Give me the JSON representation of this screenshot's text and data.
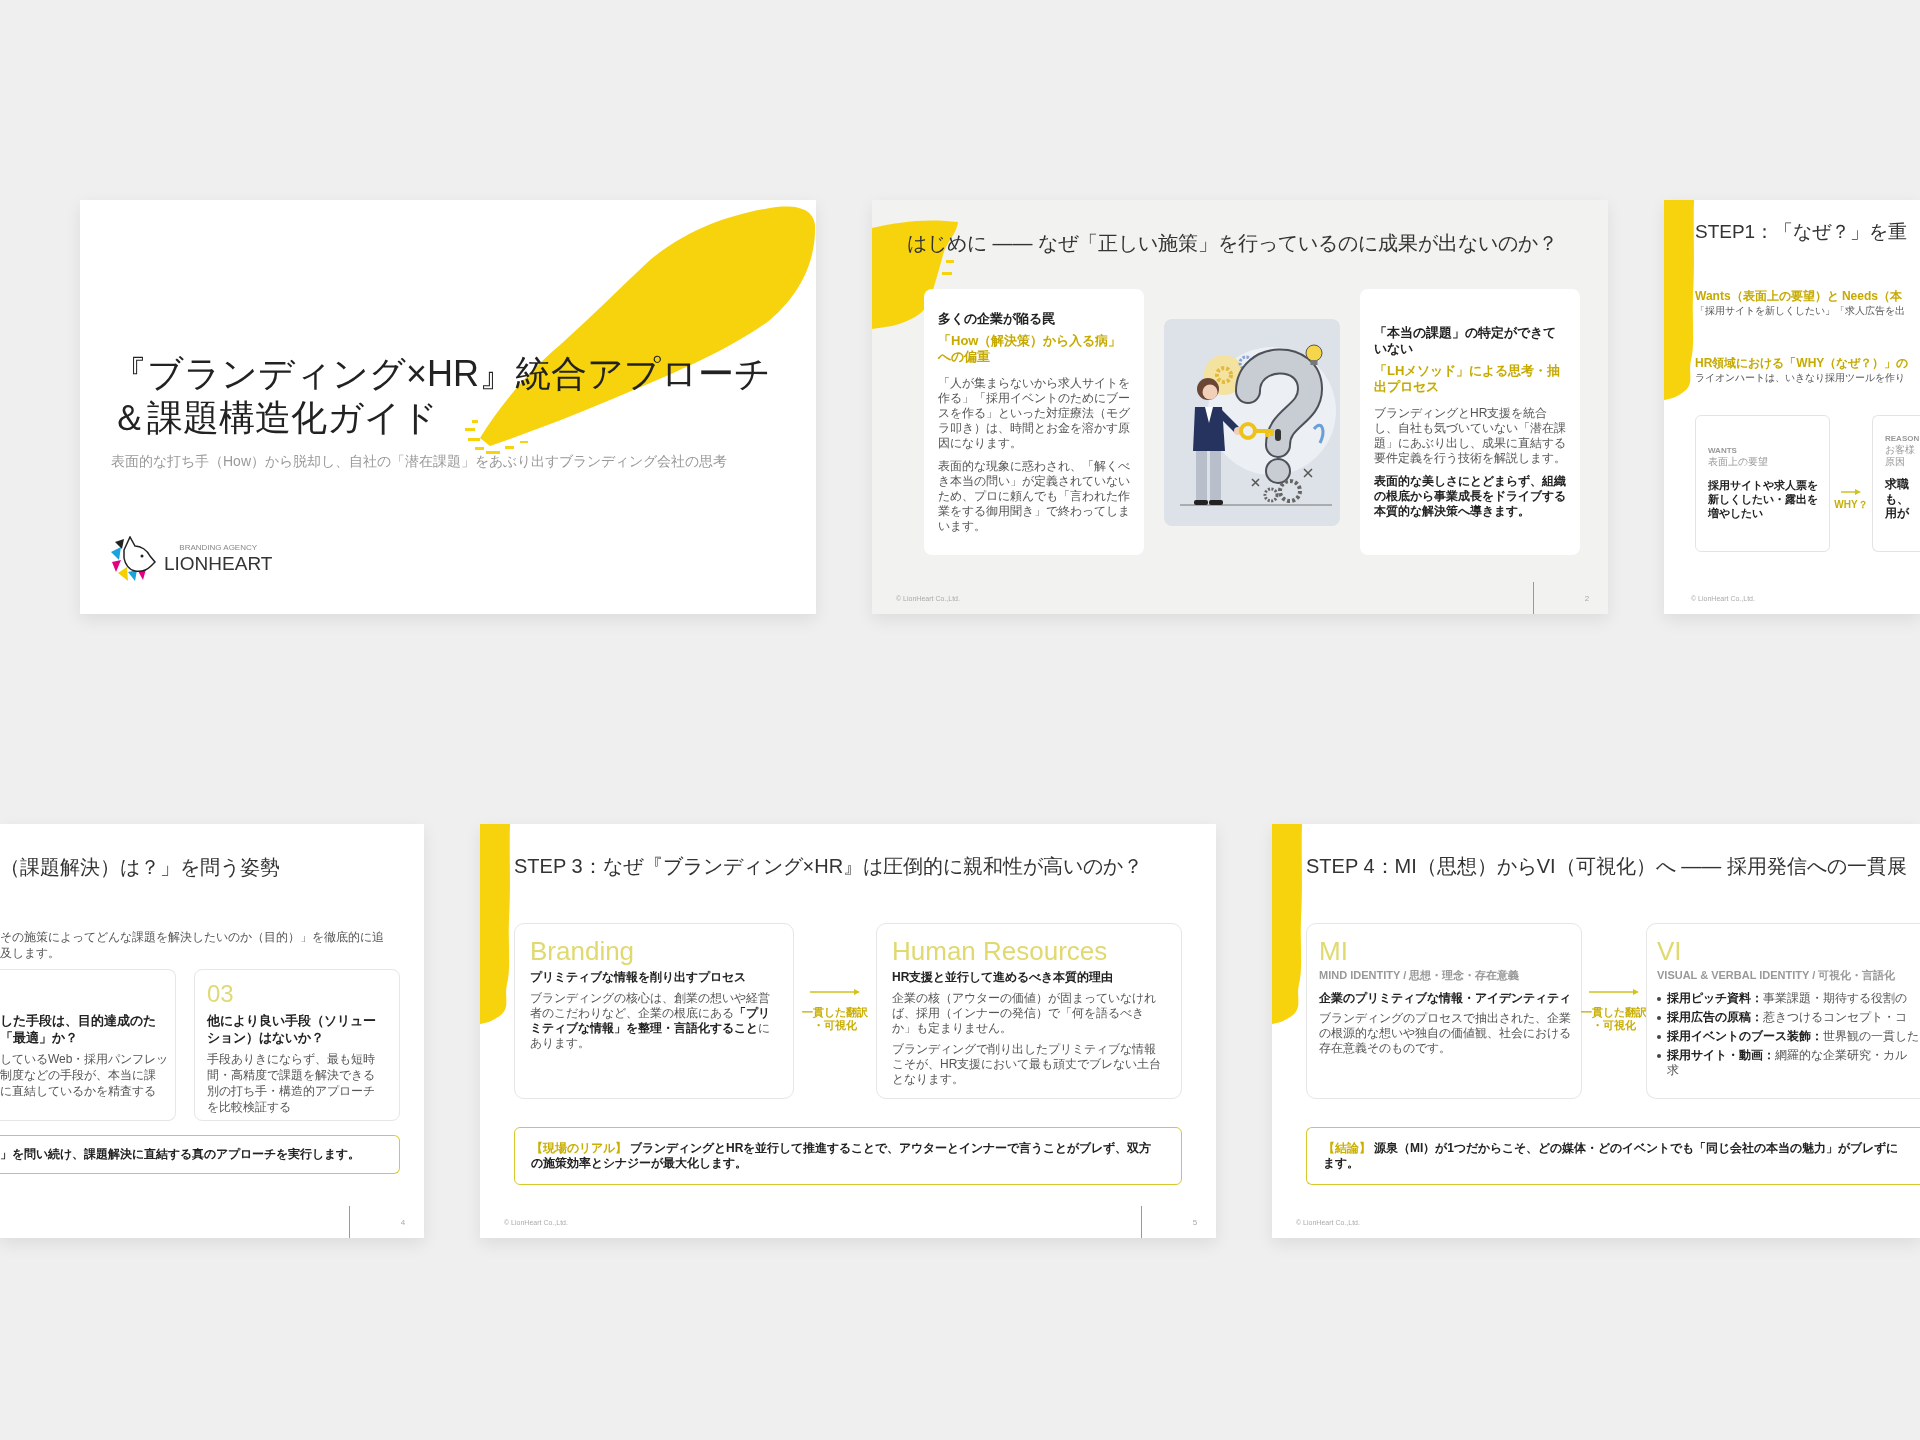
{
  "rows": [
    {
      "slides": [
        {
          "kind": "cover",
          "title": "『ブランディング×HR』統合アプローチ＆課題構造化ガイド",
          "subtitle": "表面的な打ち手（How）から脱却し、自社の「潜在課題」をあぶり出すブランディング会社の思考",
          "logo": {
            "tagline": "BRANDING AGENCY",
            "name": "LIONHEART"
          }
        },
        {
          "kind": "intro",
          "title": "はじめに —— なぜ「正しい施策」を行っているのに成果が出ないのか？",
          "cards": [
            {
              "heading": "多くの企業が陥る罠",
              "highlight": "「How（解決策）から入る病」への偏重",
              "paragraphs": [
                {
                  "text": "「人が集まらないから求人サイトを作る」「採用イベントのためにブースを作る」といった対症療法（モグラ叩き）は、時間とお金を溶かす原因になります。",
                  "emphasis": false
                },
                {
                  "text": "表面的な現象に惑わされ、「解くべき本当の問い」が定義されていないため、プロに頼んでも「言われた作業をする御用聞き」で終わってしまいます。",
                  "emphasis": false
                }
              ]
            },
            {
              "heading": "「本当の課題」の特定ができていない",
              "highlight": "「LHメソッド」による思考・抽出プロセス",
              "paragraphs": [
                {
                  "text": "ブランディングとHR支援を統合し、自社も気づいていない「潜在課題」にあぶり出し、成果に直結する要件定義を行う技術を解説します。",
                  "emphasis": false
                },
                {
                  "text": "表面的な美しさにとどまらず、組織の根底から事業成長をドライブする本質的な解決策へ導きます。",
                  "emphasis": true
                }
              ]
            }
          ],
          "footer": {
            "copyright": "© LionHeart Co.,Ltd.",
            "page": "2"
          }
        },
        {
          "kind": "flow",
          "title": "STEP1：「なぜ？」を重",
          "sections": [
            {
              "heading": "Wants（表面上の要望）と Needs（本",
              "text": "「採用サイトを新しくしたい」「求人広告を出"
            },
            {
              "heading": "HR領域における「WHY（なぜ？）」の",
              "text": "ライオンハートは、いきなり採用ツールを作り"
            }
          ],
          "steps": [
            {
              "label": "WANTS",
              "captions": [
                "表面上の要望"
              ],
              "text": "採用サイトや求人票を新しくしたい・露出を増やしたい"
            },
            {
              "label": "REASON",
              "captions": [
                "お客様",
                "原因"
              ],
              "lines": [
                "求職",
                "も、",
                "用が"
              ]
            }
          ],
          "connector": "WHY？",
          "footer": {
            "copyright": "© LionHeart Co.,Ltd."
          }
        }
      ]
    },
    {
      "slides": [
        {
          "kind": "questions",
          "title": "（課題解決）は？」を問う姿勢",
          "lead": "その施策によってどんな課題を解決したいのか（目的）」を徹底的に追及します。",
          "cards": [
            {
              "heading_lines": [
                "した手段は、目的達成のた",
                "「最適」か？"
              ],
              "lines": [
                "しているWeb・採用パンフレッ",
                "制度などの手段が、本当に課",
                "に直結しているかを精査する"
              ]
            },
            {
              "number": "03",
              "heading": "他により良い手段（ソリューション）はないか？",
              "text": "手段ありきにならず、最も短時間・高精度で課題を解決できる別の打ち手・構造的アプローチを比較検証する"
            }
          ],
          "conclusion": {
            "text": "」を問い続け、課題解決に直結する真のアプローチを実行します。"
          },
          "footer": {
            "page": "4"
          }
        },
        {
          "kind": "compare",
          "title": "STEP 3：なぜ『ブランディング×HR』は圧倒的に親和性が高いのか？",
          "cards": [
            {
              "name": "Branding",
              "heading": "プリミティブな情報を削り出すプロセス",
              "paragraphs": [
                "ブランディングの核心は、創業の想いや経営者のこだわりなど、企業の根底にある**「プリミティブな情報」を整理・言語化すること**にあります。"
              ]
            },
            {
              "name": "Human Resources",
              "heading": "HR支援と並行して進めるべき本質的理由",
              "paragraphs": [
                "企業の核（アウターの価値）が固まっていなければ、採用（インナーの発信）で「何を語るべきか」も定まりません。",
                "ブランディングで削り出したプリミティブな情報こそが、HR支援において最も頑丈でブレない土台となります。"
              ]
            }
          ],
          "connector": "一貫した翻訳・可視化",
          "conclusion": {
            "label": "【現場のリアル】",
            "text": "ブランディングとHRを並行して推進することで、アウターとインナーで言うことがブレず、双方の施策効率とシナジーが最大化します。"
          },
          "footer": {
            "copyright": "© LionHeart Co.,Ltd.",
            "page": "5"
          }
        },
        {
          "kind": "identity",
          "title": "STEP 4：MI（思想）からVI（可視化）へ —— 採用発信への一貫展",
          "cards": [
            {
              "name": "MI",
              "subtitle": "MIND IDENTITY / 思想・理念・存在意義",
              "heading": "企業のプリミティブな情報・アイデンティティ",
              "paragraphs": [
                "ブランディングのプロセスで抽出された、企業の根源的な想いや独自の価値観、社会における存在意義そのものです。"
              ]
            },
            {
              "name": "VI",
              "subtitle": "VISUAL & VERBAL IDENTITY / 可視化・言語化",
              "items": [
                {
                  "lines": [
                    "**採用ピッチ資料：**事業課題・期待する役割の"
                  ]
                },
                {
                  "lines": [
                    "**採用広告の原稿：**惹きつけるコンセプト・コ"
                  ]
                },
                {
                  "lines": [
                    "**採用イベントのブース装飾：**世界観の一貫した"
                  ]
                },
                {
                  "lines": [
                    "**採用サイト・動画：**網羅的な企業研究・カル",
                    "求"
                  ]
                }
              ]
            }
          ],
          "connector": "一貫した翻訳・可視化",
          "conclusion": {
            "label": "【結論】",
            "lines": [
              "源泉（MI）が1つだからこそ、どの媒体・どのイベントでも「同じ会社の本当の魅力」がブレずに",
              "ます。"
            ]
          },
          "footer": {
            "copyright": "© LionHeart Co.,Ltd."
          }
        }
      ]
    }
  ]
}
